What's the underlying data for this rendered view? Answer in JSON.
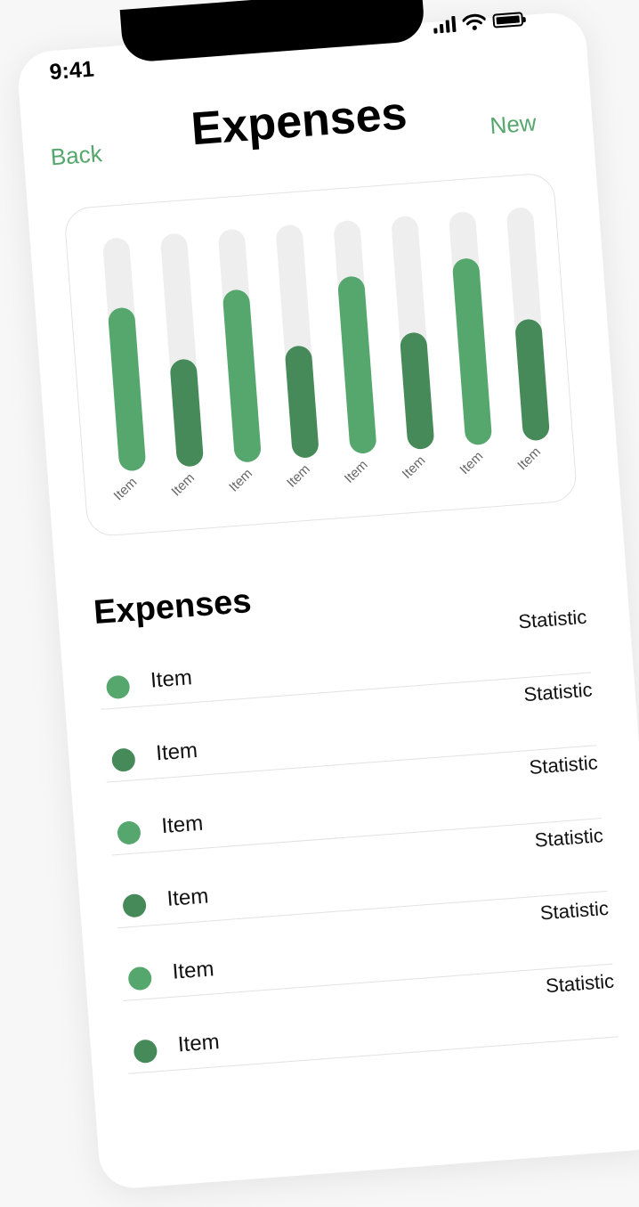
{
  "status_bar": {
    "time": "9:41",
    "icons": [
      "cellular-signal-icon",
      "wifi-icon",
      "battery-icon"
    ]
  },
  "nav": {
    "back_label": "Back",
    "title": "Expenses",
    "new_label": "New"
  },
  "colors": {
    "accent": "#56a76e",
    "dark": "#468a59",
    "track": "#eeeeee"
  },
  "chart_data": {
    "type": "bar",
    "categories": [
      "Item",
      "Item",
      "Item",
      "Item",
      "Item",
      "Item",
      "Item",
      "Item"
    ],
    "values": [
      70,
      46,
      74,
      48,
      76,
      50,
      80,
      52
    ],
    "ylim": [
      0,
      100
    ],
    "bar_colors": [
      "#56a76e",
      "#468a59",
      "#56a76e",
      "#468a59",
      "#56a76e",
      "#468a59",
      "#56a76e",
      "#468a59"
    ],
    "grid": false,
    "title": "",
    "xlabel": "",
    "ylabel": ""
  },
  "list": {
    "title": "Expenses",
    "items": [
      {
        "label": "Item",
        "stat": "Statistic",
        "color": "#56a76e"
      },
      {
        "label": "Item",
        "stat": "Statistic",
        "color": "#468a59"
      },
      {
        "label": "Item",
        "stat": "Statistic",
        "color": "#56a76e"
      },
      {
        "label": "Item",
        "stat": "Statistic",
        "color": "#468a59"
      },
      {
        "label": "Item",
        "stat": "Statistic",
        "color": "#56a76e"
      },
      {
        "label": "Item",
        "stat": "Statistic",
        "color": "#468a59"
      }
    ]
  }
}
